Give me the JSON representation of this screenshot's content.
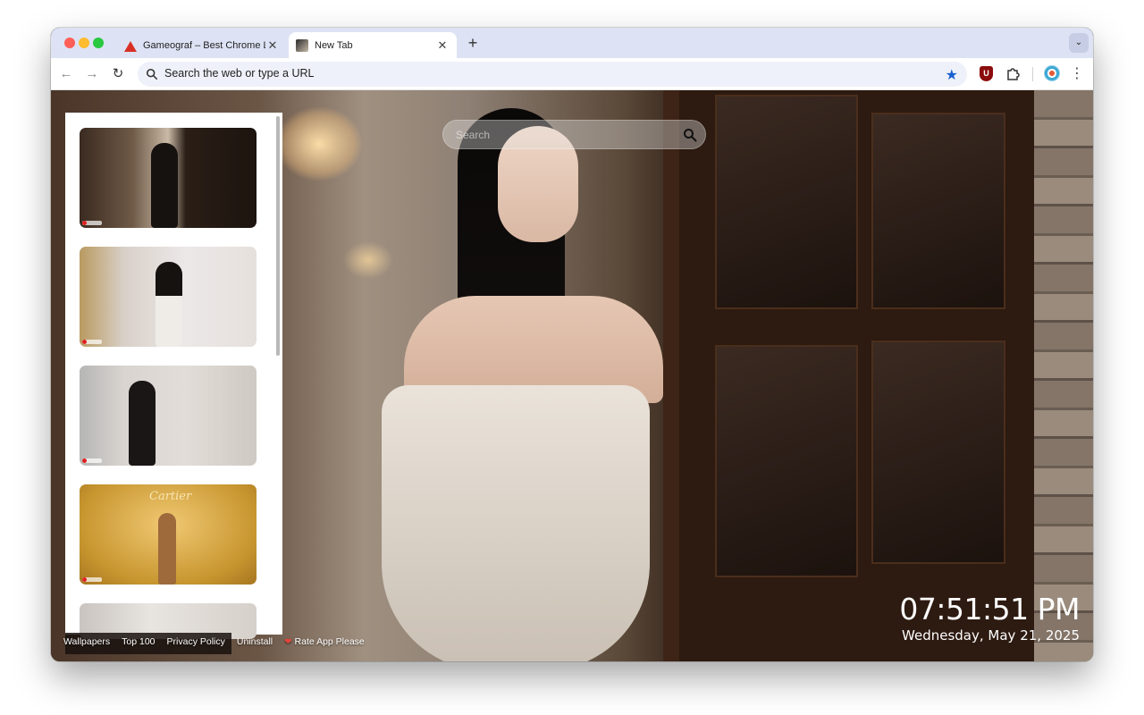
{
  "tabs": [
    {
      "title": "Gameograf – Best Chrome Li",
      "active": false,
      "icon": "gameograf-favicon"
    },
    {
      "title": "New Tab",
      "active": true,
      "icon": "newtab-wallpaper-favicon"
    }
  ],
  "new_tab_label": "+",
  "tab_search_label": "⌄",
  "omnibox": {
    "placeholder": "Search the web or type a URL"
  },
  "toolbar": {
    "back": "←",
    "forward": "→",
    "reload": "↻",
    "menu": "⋮",
    "ublock_label": "U"
  },
  "search": {
    "placeholder": "Search"
  },
  "thumbnails": [
    {
      "label": "wallpaper-1"
    },
    {
      "label": "wallpaper-2"
    },
    {
      "label": "wallpaper-3"
    },
    {
      "label": "wallpaper-4",
      "brand_text": "Cartier"
    },
    {
      "label": "wallpaper-5"
    }
  ],
  "footer": {
    "links": [
      "Wallpapers",
      "Top 100",
      "Privacy Policy",
      "Uninstall",
      "Rate App Please"
    ]
  },
  "clock": {
    "time": "07:51:51 PM",
    "date": "Wednesday, May 21, 2025"
  },
  "colors": {
    "accent_star": "#1a5fd1",
    "tab_strip": "#dde3f4",
    "heart": "#e2453c"
  }
}
